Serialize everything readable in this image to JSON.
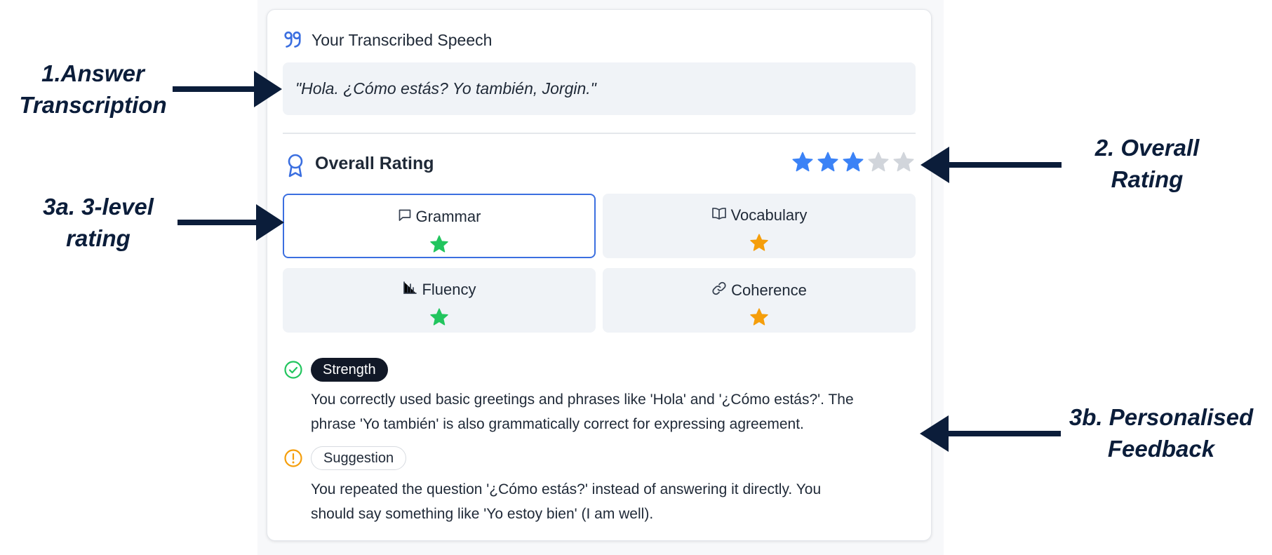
{
  "speech": {
    "title": "Your Transcribed Speech",
    "icon": "quote-icon",
    "transcript": "\"Hola. ¿Cómo estás? Yo también, Jorgin.\""
  },
  "rating": {
    "title": "Overall Rating",
    "icon": "award-icon",
    "stars_filled": 3,
    "stars_total": 5,
    "star_color": "#3b82f6",
    "star_empty_color": "#d1d5db"
  },
  "criteria": [
    {
      "label": "Grammar",
      "icon": "message-square-icon",
      "star_color": "#22c55e",
      "selected": true
    },
    {
      "label": "Vocabulary",
      "icon": "book-open-icon",
      "star_color": "#f59e0b",
      "selected": false
    },
    {
      "label": "Fluency",
      "icon": "bar-chart-icon",
      "star_color": "#22c55e",
      "selected": false
    },
    {
      "label": "Coherence",
      "icon": "link-icon",
      "star_color": "#f59e0b",
      "selected": false
    }
  ],
  "feedback": {
    "strength": {
      "label": "Strength",
      "icon": "check-circle-icon",
      "color": "#22c55e",
      "lines": [
        "You correctly used basic greetings and phrases like 'Hola' and '¿Cómo estás?'. The",
        "phrase 'Yo también' is also grammatically correct for expressing agreement."
      ]
    },
    "suggestion": {
      "label": "Suggestion",
      "icon": "alert-circle-icon",
      "color": "#f59e0b",
      "lines": [
        "You repeated the question '¿Cómo estás?' instead of answering it directly. You",
        "should say something like 'Yo estoy bien' (I am well)."
      ]
    }
  },
  "annotations": {
    "transcription": [
      "1.Answer",
      "Transcription"
    ],
    "overall": [
      "2. Overall",
      "Rating"
    ],
    "three_level": [
      "3a. 3-level",
      "rating"
    ],
    "feedback": [
      "3b. Personalised",
      "Feedback"
    ],
    "color": "#0b1d3a"
  }
}
